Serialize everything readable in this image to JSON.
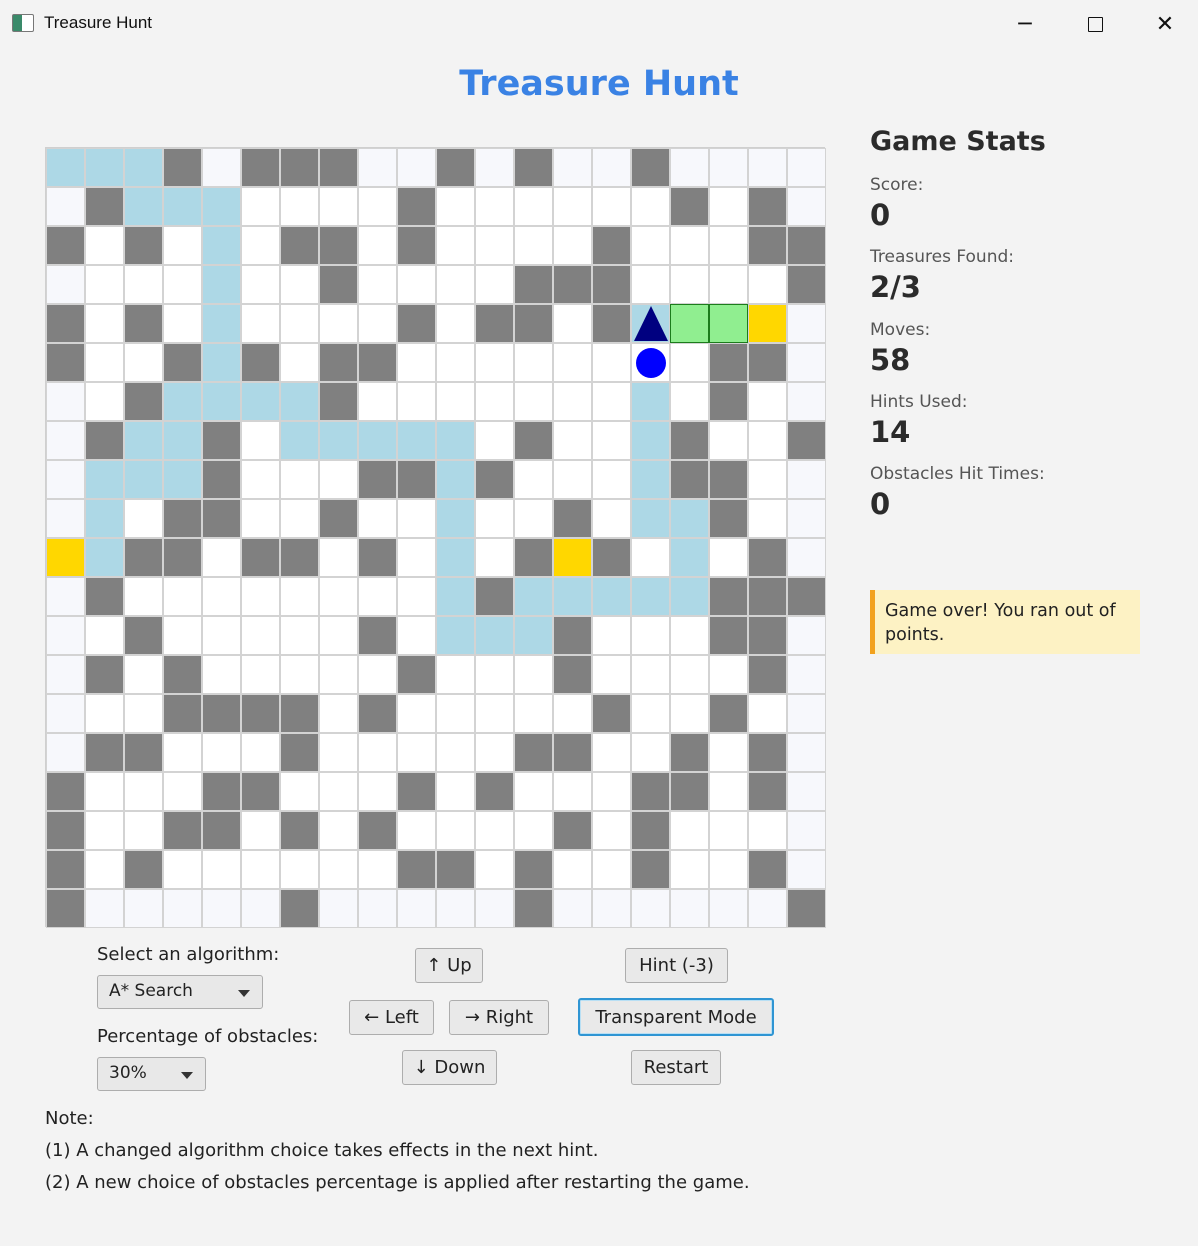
{
  "window": {
    "title": "Treasure Hunt",
    "minimize": "─",
    "close": "✕"
  },
  "heading": "Treasure Hunt",
  "grid": {
    "size": 20,
    "legend": {
      "W": "empty",
      "L": "light-empty",
      "O": "obstacle",
      "P": "hint-path",
      "G": "visited-goal",
      "T": "treasure"
    },
    "rows": [
      "PPPOLOOOLLOLOLLOLLLL",
      "LOPPPWWWWOWWWWWWOWOL",
      "OWOWPWOOWOWWWWOWWWOO",
      "LWWWPWWOWWWWOOOWWWWO",
      "OWOWPWWWWOWOOWOPGGTL",
      "OWWOPOWOOWWWWWWWWOOL",
      "LWOPPPPOWWWWWWWPWOWL",
      "LOPPOWPPPPPWOWWPOWWO",
      "LPPPOWWWOOPOWWWPOOWL",
      "LPWOOWWOWWPWWOWPPOWL",
      "TPOOWOOWOWPWOTOWPWOL",
      "LOWWWWWWWWPOPPPPPOOO",
      "LWOWWWWWOWPPPOWWWOOL",
      "LOWOWWWWWOWWWOWWWWOL",
      "LWWOOOOWOWWWWWOWWOWL",
      "LOOWWWOWWWWWOOWWOWOL",
      "OWWWOOWWWOWOWWWOOWOL",
      "OWWOOWOWOWWWWOWOWWWL",
      "OWOWWWWWWOOWOWWOWWOL",
      "OLLLLLOLLLLLOLLLLLLO"
    ],
    "player": {
      "row": 4,
      "col": 15,
      "shape": "triangle",
      "color": "#000080"
    },
    "token": {
      "row": 5,
      "col": 15,
      "shape": "circle",
      "color": "#0000ff"
    }
  },
  "stats": {
    "title": "Game Stats",
    "score_label": "Score:",
    "score": "0",
    "treasures_label": "Treasures Found:",
    "treasures": "2/3",
    "moves_label": "Moves:",
    "moves": "58",
    "hints_label": "Hints Used:",
    "hints": "14",
    "obstacles_label": "Obstacles Hit Times:",
    "obstacles": "0",
    "message": "Game over! You ran out of points."
  },
  "controls": {
    "algorithm_label": "Select an algorithm:",
    "algorithm_value": "A* Search",
    "obstacles_label": "Percentage of obstacles:",
    "obstacles_value": "30%",
    "up": "↑ Up",
    "left": "← Left",
    "right": "→ Right",
    "down": "↓ Down",
    "hint": "Hint (-3)",
    "transparent": "Transparent Mode",
    "restart": "Restart"
  },
  "notes": {
    "title": "Note:",
    "line1": "(1) A changed algorithm choice takes effects in the next hint.",
    "line2": "(2) A new choice of obstacles percentage is applied after restarting the game."
  },
  "colors": {
    "accent": "#3a82e4",
    "obstacle": "#808080",
    "path": "#add8e6",
    "goal": "#90ee90",
    "treasure": "#ffd700",
    "alert_bg": "#fdf2c4",
    "alert_border": "#f2a11d",
    "focus": "#2f95d3"
  }
}
